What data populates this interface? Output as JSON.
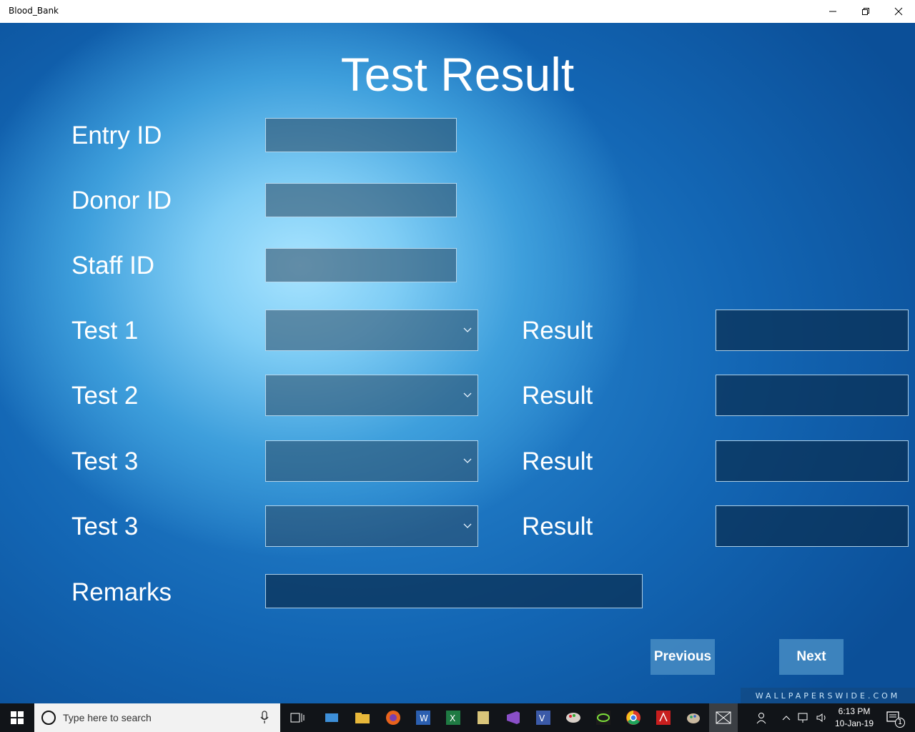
{
  "window": {
    "title": "Blood_Bank",
    "minimize_icon": "minimize-icon",
    "maximize_icon": "restore-icon",
    "close_icon": "close-icon"
  },
  "page": {
    "title": "Test Result"
  },
  "form": {
    "entry_id_label": "Entry ID",
    "donor_id_label": "Donor ID",
    "staff_id_label": "Staff ID",
    "entry_id_value": "",
    "donor_id_value": "",
    "staff_id_value": "",
    "tests": [
      {
        "label": "Test 1",
        "selected": "",
        "result_label": "Result",
        "result_value": ""
      },
      {
        "label": "Test 2",
        "selected": "",
        "result_label": "Result",
        "result_value": ""
      },
      {
        "label": "Test 3",
        "selected": "",
        "result_label": "Result",
        "result_value": ""
      },
      {
        "label": "Test 3",
        "selected": "",
        "result_label": "Result",
        "result_value": ""
      }
    ],
    "remarks_label": "Remarks",
    "remarks_value": ""
  },
  "buttons": {
    "previous": "Previous",
    "next": "Next"
  },
  "watermark": "WALLPAPERSWIDE.COM",
  "taskbar": {
    "search_placeholder": "Type here to search",
    "time": "6:13 PM",
    "date": "10-Jan-19",
    "notification_count": "1"
  },
  "colors": {
    "accent": "#1a6bb8",
    "button": "#468cc3",
    "taskbar": "#111418"
  }
}
